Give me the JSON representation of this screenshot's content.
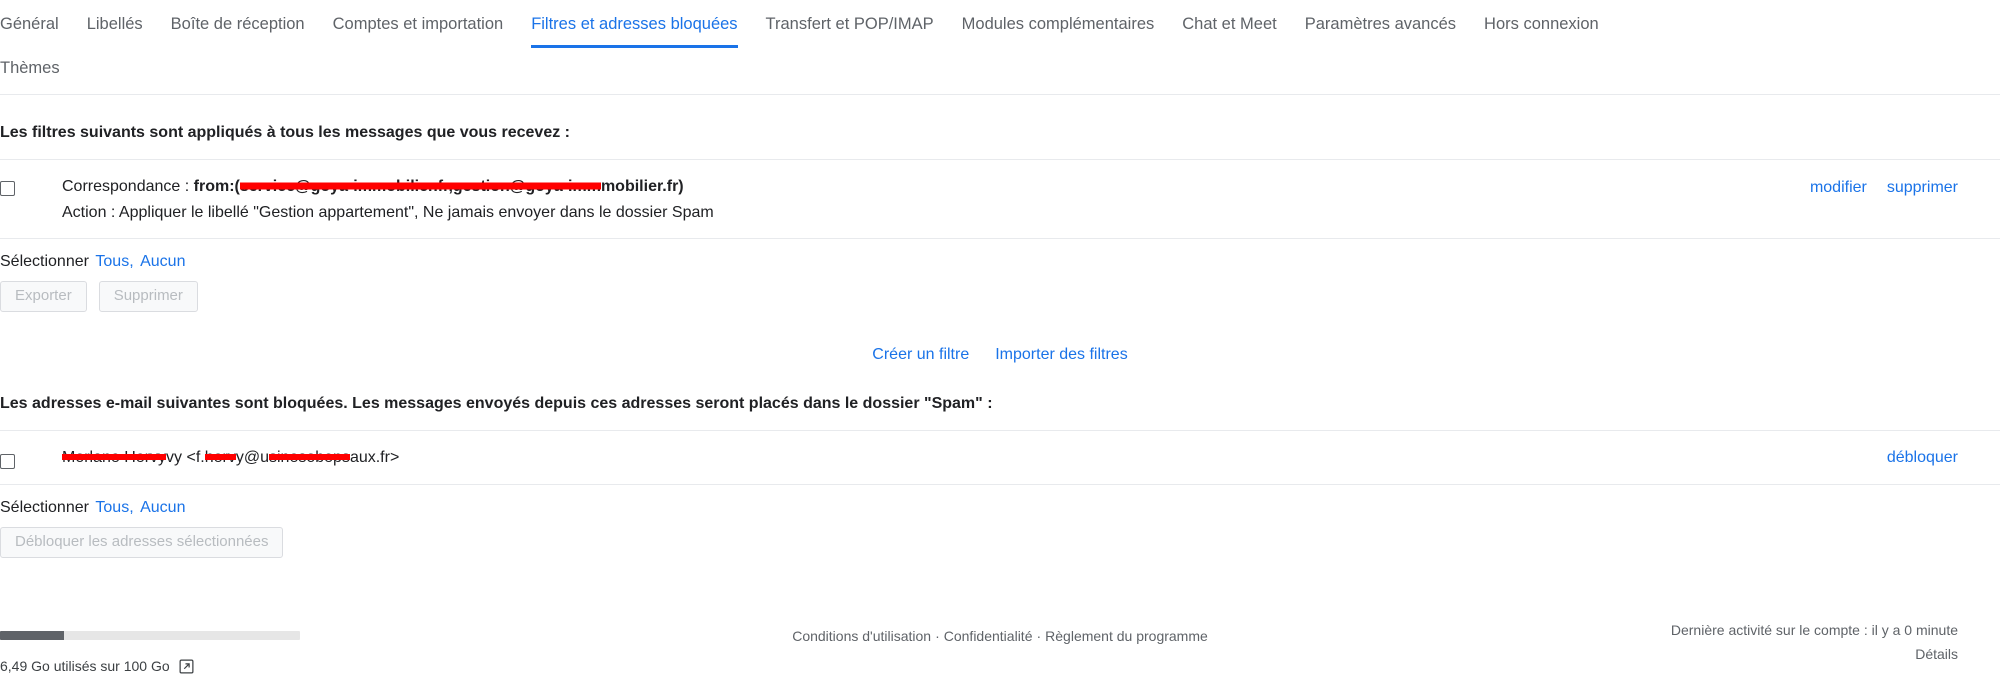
{
  "tabs": {
    "row1": [
      {
        "label": "Général",
        "active": false
      },
      {
        "label": "Libellés",
        "active": false
      },
      {
        "label": "Boîte de réception",
        "active": false
      },
      {
        "label": "Comptes et importation",
        "active": false
      },
      {
        "label": "Filtres et adresses bloquées",
        "active": true
      },
      {
        "label": "Transfert et POP/IMAP",
        "active": false
      },
      {
        "label": "Modules complémentaires",
        "active": false
      },
      {
        "label": "Chat et Meet",
        "active": false
      },
      {
        "label": "Paramètres avancés",
        "active": false
      },
      {
        "label": "Hors connexion",
        "active": false
      }
    ],
    "row2": [
      {
        "label": "Thèmes",
        "active": false
      }
    ],
    "accent_color": "#1a73e8"
  },
  "filters_section": {
    "heading": "Les filtres suivants sont appliqués à tous les messages que vous recevez :",
    "rows": [
      {
        "match_label": "Correspondance : ",
        "match_prefix": "from:(",
        "match_redacted_1": "service@goya-immobilier.fr,gestion@goya-imm",
        "match_suffix": "mobilier.fr)",
        "action_text": "Action : Appliquer le libellé \"Gestion appartement\", Ne jamais envoyer dans le dossier Spam",
        "edit_label": "modifier",
        "delete_label": "supprimer"
      }
    ],
    "select_label": "Sélectionner",
    "select_all": "Tous,",
    "select_none": "Aucun",
    "export_button": "Exporter",
    "delete_button": "Supprimer",
    "create_filter_link": "Créer un filtre",
    "import_filters_link": "Importer des filtres"
  },
  "blocked_section": {
    "heading": "Les adresses e-mail suivantes sont bloquées. Les messages envoyés depuis ces adresses seront placés dans le dossier \"Spam\" :",
    "rows": [
      {
        "name_redacted": "Morlane Hervy",
        "name_tail": "vy",
        "email_prefix": " <f.",
        "email_redacted_1": "herv",
        "email_mid": "y@u",
        "email_redacted_2": "sinesobeps",
        "email_suffix": "aux.fr>",
        "unblock_label": "débloquer"
      }
    ],
    "select_label": "Sélectionner",
    "select_all": "Tous,",
    "select_none": "Aucun",
    "unblock_button": "Débloquer les adresses sélectionnées"
  },
  "footer": {
    "storage_used_percent": 6.49,
    "storage_text": "6,49 Go utilisés sur 100 Go",
    "links": [
      "Conditions d'utilisation",
      "Confidentialité",
      "Règlement du programme"
    ],
    "separator": "·",
    "last_activity": "Dernière activité sur le compte : il y a 0 minute",
    "details_label": "Détails"
  }
}
